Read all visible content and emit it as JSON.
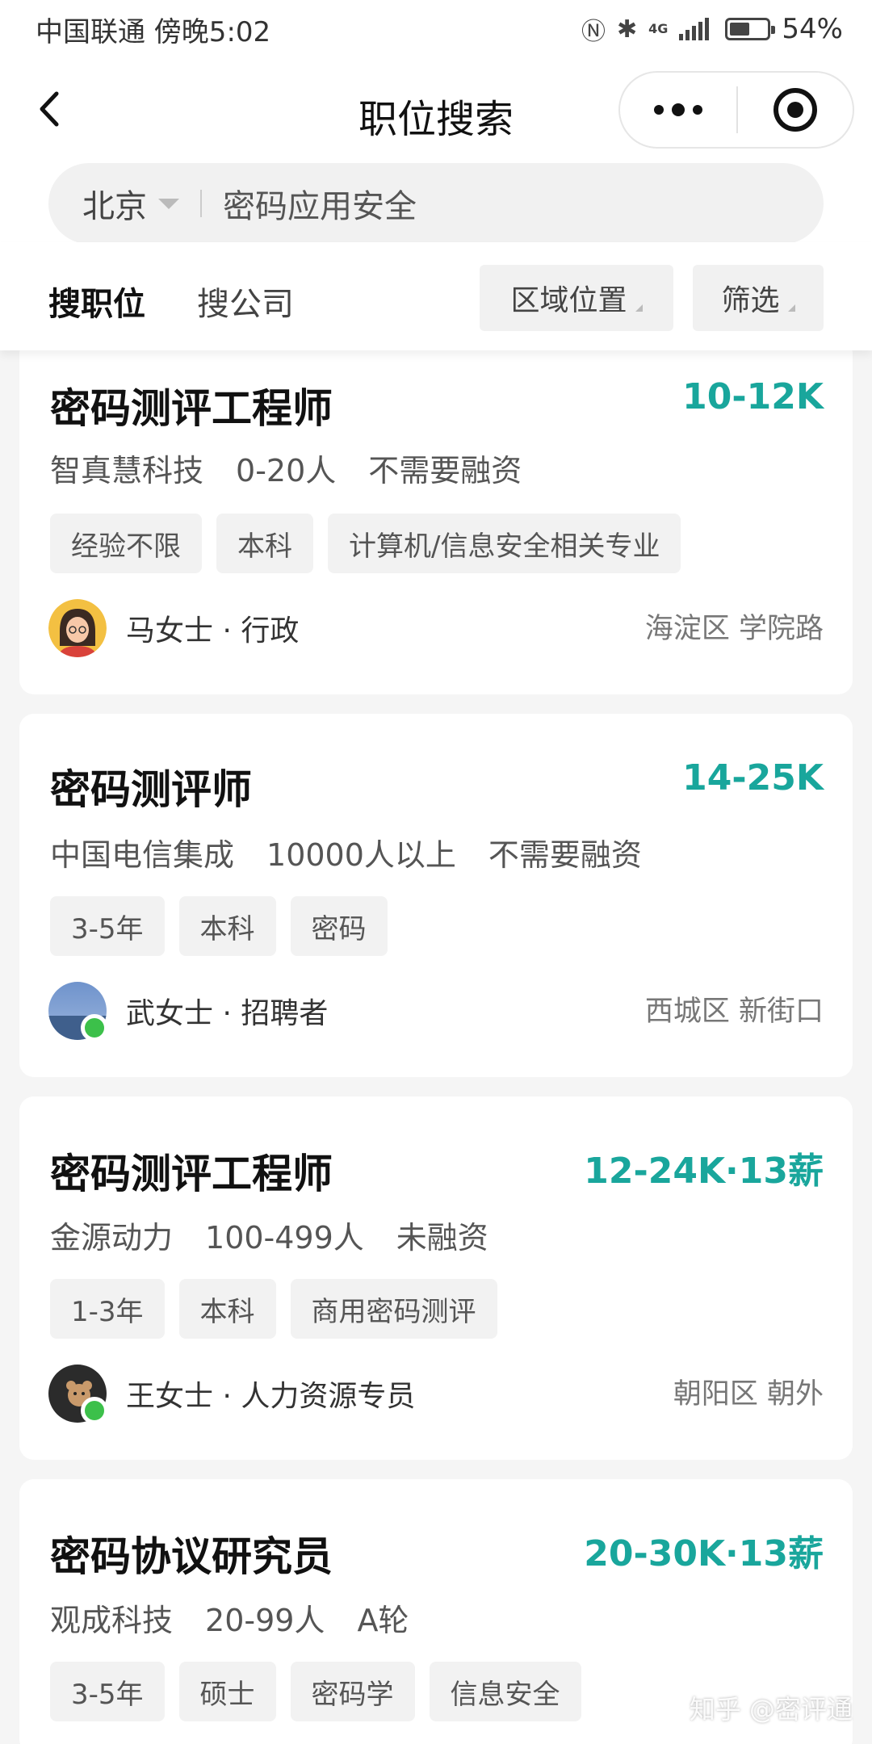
{
  "status_bar": {
    "carrier": "中国联通 傍晚5:02",
    "network": "4G",
    "battery_percent": 54,
    "battery_label": "54%"
  },
  "nav": {
    "title": "职位搜索",
    "back_icon": "chevron-left-icon",
    "more_icon": "more-dots-icon",
    "close_icon": "target-icon"
  },
  "search": {
    "city": "北京",
    "query": "密码应用安全"
  },
  "filters": {
    "tab_jobs": "搜职位",
    "tab_companies": "搜公司",
    "area": "区域位置",
    "filter": "筛选"
  },
  "colors": {
    "salary": "#19a69c",
    "online": "#3cc04a"
  },
  "jobs": [
    {
      "title": "密码测评工程师",
      "salary": "10-12K",
      "company": "智真慧科技",
      "size": "0-20人",
      "funding": "不需要融资",
      "tags": [
        "经验不限",
        "本科",
        "计算机/信息安全相关专业"
      ],
      "recruiter": "马女士 · 行政",
      "location": "海淀区 学院路"
    },
    {
      "title": "密码测评师",
      "salary": "14-25K",
      "company": "中国电信集成",
      "size": "10000人以上",
      "funding": "不需要融资",
      "tags": [
        "3-5年",
        "本科",
        "密码"
      ],
      "recruiter": "武女士 · 招聘者",
      "location": "西城区 新街口"
    },
    {
      "title": "密码测评工程师",
      "salary": "12-24K·13薪",
      "company": "金源动力",
      "size": "100-499人",
      "funding": "未融资",
      "tags": [
        "1-3年",
        "本科",
        "商用密码测评"
      ],
      "recruiter": "王女士 · 人力资源专员",
      "location": "朝阳区 朝外"
    },
    {
      "title": "密码协议研究员",
      "salary": "20-30K·13薪",
      "company": "观成科技",
      "size": "20-99人",
      "funding": "A轮",
      "tags": [
        "3-5年",
        "硕士",
        "密码学",
        "信息安全"
      ]
    }
  ],
  "watermark": "知乎 @密评通"
}
